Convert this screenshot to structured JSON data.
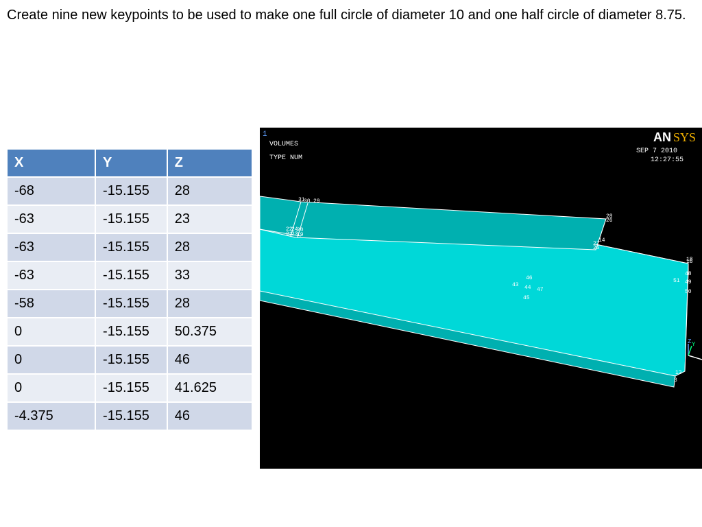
{
  "instruction": "Create nine new keypoints to be used to make one full circle of diameter 10 and one half circle of diameter 8.75.",
  "table": {
    "headers": [
      "X",
      "Y",
      "Z"
    ],
    "rows": [
      [
        "-68",
        "-15.155",
        "28"
      ],
      [
        "-63",
        "-15.155",
        "23"
      ],
      [
        "-63",
        "-15.155",
        "28"
      ],
      [
        "-63",
        "-15.155",
        "33"
      ],
      [
        "-58",
        "-15.155",
        "28"
      ],
      [
        "0",
        "-15.155",
        "50.375"
      ],
      [
        "0",
        "-15.155",
        "46"
      ],
      [
        "0",
        "-15.155",
        "41.625"
      ],
      [
        "-4.375",
        "-15.155",
        "46"
      ]
    ]
  },
  "viewport": {
    "window_number": "1",
    "line1": "VOLUMES",
    "line2": "TYPE NUM",
    "date": "SEP  7 2010",
    "time": "12:27:55",
    "logo_an": "AN",
    "logo_sys": "SYS",
    "axis_z": "Z",
    "axis_y": "Y",
    "colors": {
      "body": "#00d8d8",
      "top": "#00b0b0",
      "edge": "#ffffff",
      "logo_sys": "#f0b000"
    },
    "keypoint_labels": {
      "kp_31": "31",
      "kp_30": "30",
      "kp_29": "29",
      "kp_28": "28",
      "kp_26": "26",
      "kp_14": "14",
      "kp_27": "27",
      "kp_25": "25",
      "kp_46": "46",
      "kp_43": "43",
      "kp_44": "44",
      "kp_47": "47",
      "kp_45": "45",
      "kp_18": "18",
      "kp_16": "16",
      "kp_48": "48",
      "kp_51": "51",
      "kp_49": "49",
      "kp_50": "50",
      "kp_3": "3",
      "kp_13": "13",
      "kp_left_a": "22",
      "kp_left_b": "24",
      "kp_left_c": "20",
      "kp_left_d": "21",
      "kp_left_e": "23",
      "kp_left_f": "19"
    }
  }
}
